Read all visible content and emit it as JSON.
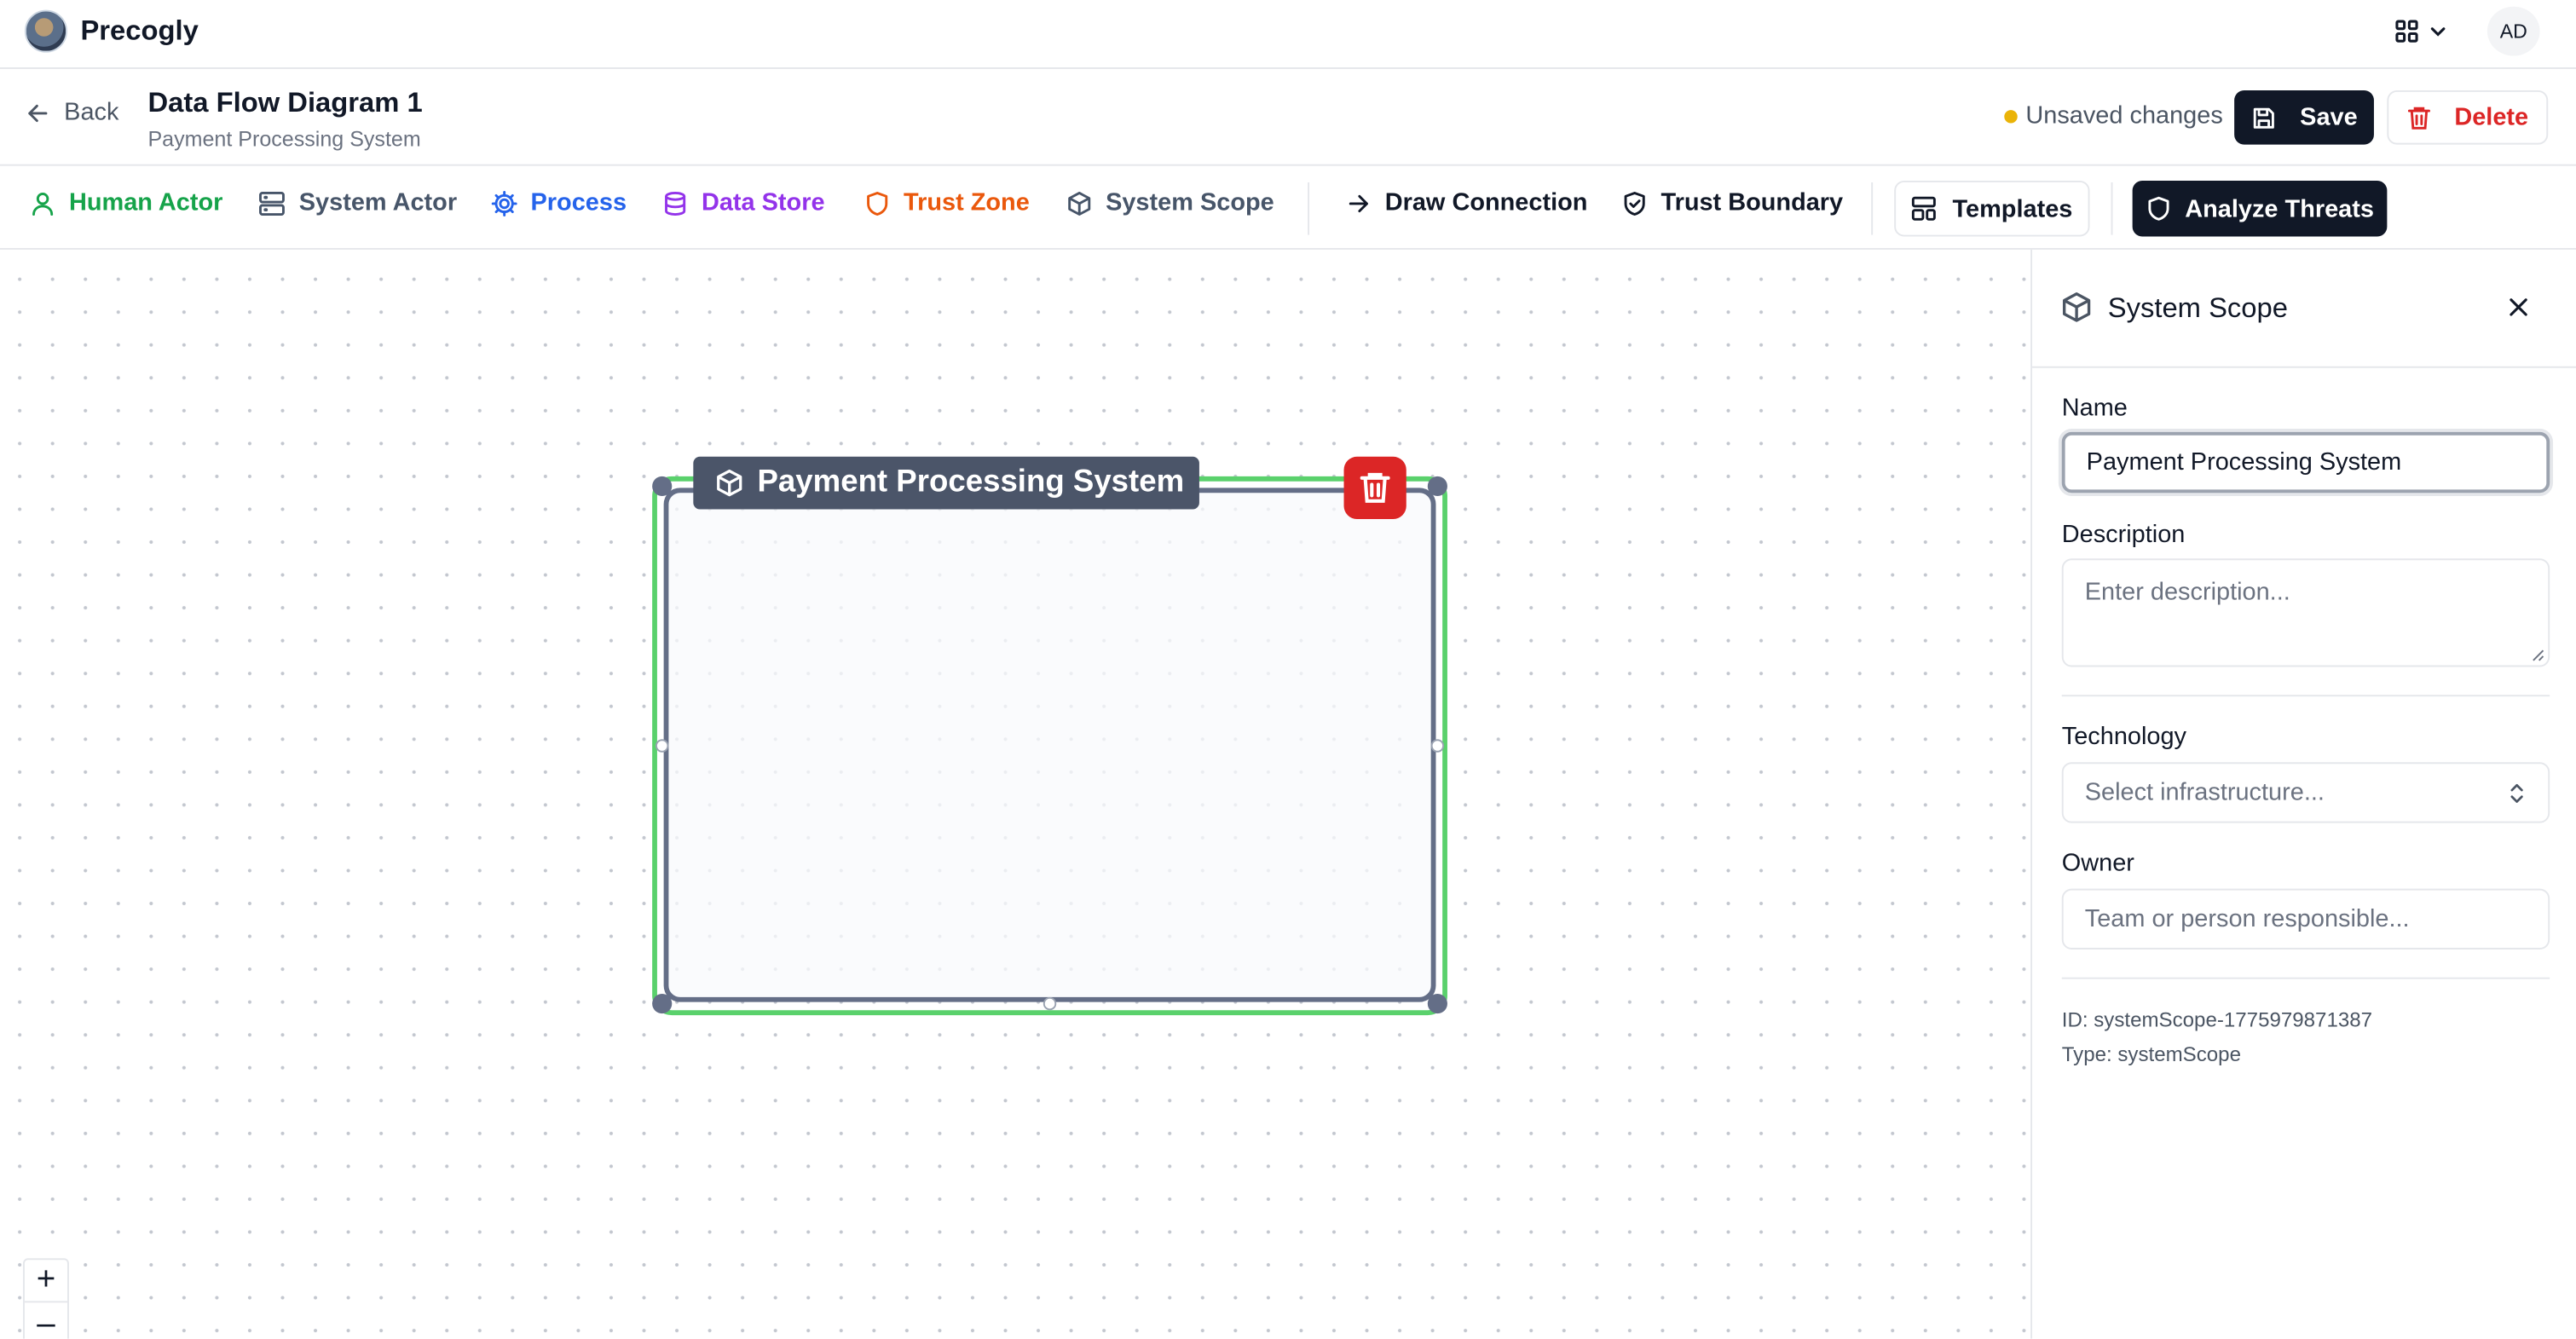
{
  "app": {
    "name": "Precogly",
    "user_initials": "AD"
  },
  "header": {
    "back_label": "Back",
    "title": "Data Flow Diagram 1",
    "subtitle": "Payment Processing System",
    "unsaved_label": "Unsaved changes",
    "save_label": "Save",
    "delete_label": "Delete"
  },
  "toolbar": {
    "items": [
      {
        "label": "Human Actor",
        "icon": "user-icon",
        "color": "#16a34a"
      },
      {
        "label": "System Actor",
        "icon": "server-icon",
        "color": "#475569"
      },
      {
        "label": "Process",
        "icon": "cog-icon",
        "color": "#2563eb"
      },
      {
        "label": "Data Store",
        "icon": "database-icon",
        "color": "#9333ea"
      },
      {
        "label": "Trust Zone",
        "icon": "shield-icon",
        "color": "#ea580c"
      },
      {
        "label": "System Scope",
        "icon": "box-icon",
        "color": "#475569"
      }
    ],
    "draw_connection": "Draw Connection",
    "trust_boundary": "Trust Boundary",
    "templates": "Templates",
    "analyze_threats": "Analyze Threats"
  },
  "canvas": {
    "node_label": "Payment Processing System",
    "zoom_in": "+",
    "zoom_out": "–"
  },
  "panel": {
    "title": "System Scope",
    "name_label": "Name",
    "name_value": "Payment Processing System",
    "description_label": "Description",
    "description_placeholder": "Enter description...",
    "technology_label": "Technology",
    "technology_placeholder": "Select infrastructure...",
    "owner_label": "Owner",
    "owner_placeholder": "Team or person responsible...",
    "id_text": "ID: systemScope-1775979871387",
    "type_text": "Type: systemScope"
  },
  "colors": {
    "accent_dark": "#111827",
    "danger": "#dc2626",
    "selection_green": "#5ad16c",
    "scope_border": "#646e87",
    "unsaved_dot": "#eab308"
  }
}
